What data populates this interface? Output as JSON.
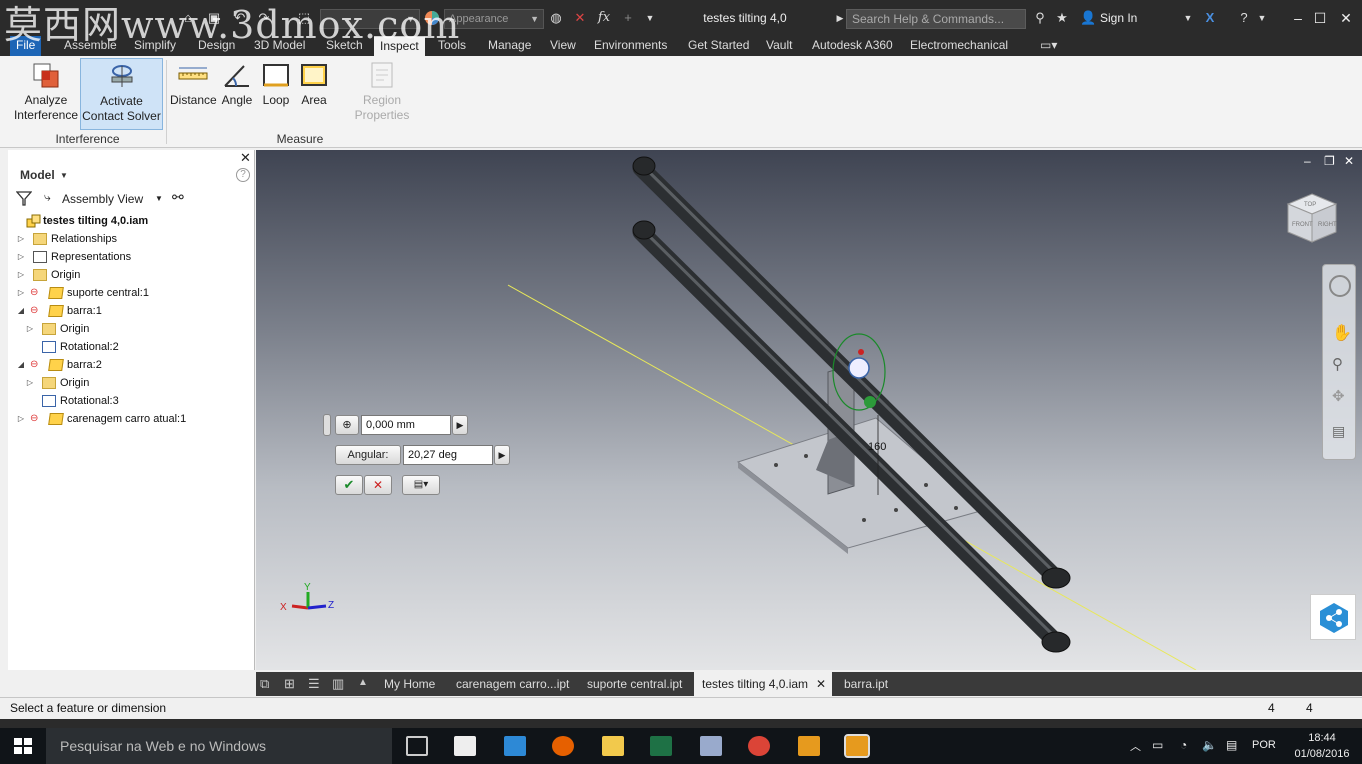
{
  "watermark": "莫西网www.3dmox.com",
  "titlebar": {
    "doc_title": "testes tilting 4,0",
    "search_placeholder": "Search Help & Commands...",
    "sign_in": "Sign In",
    "material_combo": "",
    "appearance_combo": "Appearance"
  },
  "ribbon_tabs": [
    "File",
    "Assemble",
    "Simplify",
    "Design",
    "3D Model",
    "Sketch",
    "Inspect",
    "Tools",
    "Manage",
    "View",
    "Environments",
    "Get Started",
    "Vault",
    "Autodesk A360",
    "Electromechanical"
  ],
  "ribbon": {
    "analyze_interference": [
      "Analyze",
      "Interference"
    ],
    "activate_contact_solver": [
      "Activate",
      "Contact Solver"
    ],
    "distance": "Distance",
    "angle": "Angle",
    "loop": "Loop",
    "area": "Area",
    "region_properties": "Region Properties",
    "group_interference": "Interference",
    "group_measure": "Measure"
  },
  "browser": {
    "title": "Model",
    "view_mode": "Assembly View",
    "tree": [
      {
        "label": "testes tilting 4,0.iam",
        "level": 0,
        "icon": "assembly-icon",
        "expander": "",
        "bold": true
      },
      {
        "label": "Relationships",
        "level": 1,
        "icon": "folder-icon",
        "expander": "▷"
      },
      {
        "label": "Representations",
        "level": 1,
        "icon": "representations-icon",
        "expander": "▷"
      },
      {
        "label": "Origin",
        "level": 1,
        "icon": "folder-icon",
        "expander": "▷"
      },
      {
        "label": "suporte central:1",
        "level": 1,
        "icon": "part-icon",
        "expander": "▷"
      },
      {
        "label": "barra:1",
        "level": 1,
        "icon": "part-icon",
        "expander": "◢"
      },
      {
        "label": "Origin",
        "level": 2,
        "icon": "folder-icon",
        "expander": "▷"
      },
      {
        "label": "Rotational:2",
        "level": 2,
        "icon": "constraint-icon",
        "expander": ""
      },
      {
        "label": "barra:2",
        "level": 1,
        "icon": "part-icon",
        "expander": "◢"
      },
      {
        "label": "Origin",
        "level": 2,
        "icon": "folder-icon",
        "expander": "▷"
      },
      {
        "label": "Rotational:3",
        "level": 2,
        "icon": "constraint-icon",
        "expander": ""
      },
      {
        "label": "carenagem carro atual:1",
        "level": 1,
        "icon": "part-icon",
        "expander": "▷"
      }
    ]
  },
  "minitoolbar": {
    "offset_value": "0,000 mm",
    "angular_label": "Angular:",
    "angular_value": "20,27 deg"
  },
  "viewport": {
    "dimension_label": "160",
    "viewcube_faces": [
      "TOP",
      "FRONT",
      "RIGHT"
    ],
    "triad": {
      "x": "X",
      "y": "Y",
      "z": "Z"
    }
  },
  "doc_tabs": [
    "My Home",
    "carenagem carro...ipt",
    "suporte central.ipt",
    "testes tilting 4,0.iam",
    "barra.ipt"
  ],
  "active_doc_tab": "testes tilting 4,0.iam",
  "status": {
    "text": "Select a feature or dimension",
    "count_1": "4",
    "count_2": "4"
  },
  "taskbar": {
    "search_placeholder": "Pesquisar na Web e no Windows",
    "language": "POR",
    "time": "18:44",
    "date": "01/08/2016"
  },
  "colors": {
    "file_tab": "#1d65b6",
    "active_button": "#cfe3f7",
    "yellow_axis": "#e8e85a",
    "rod": "#3b3f42"
  }
}
